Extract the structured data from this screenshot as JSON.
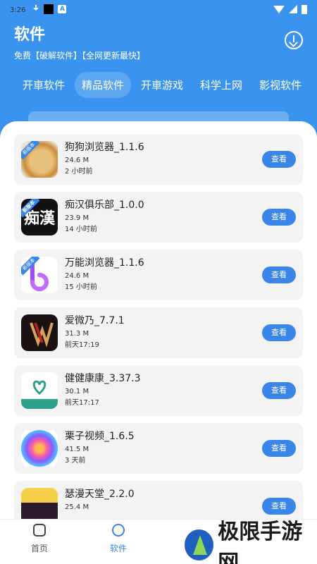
{
  "status": {
    "time": "3:26"
  },
  "header": {
    "title": "软件",
    "subtitle": "免费【破解软件】【全网更新最快】"
  },
  "tabs": [
    {
      "label": "开車软件"
    },
    {
      "label": "精品软件",
      "active": true
    },
    {
      "label": "开車游戏"
    },
    {
      "label": "科学上网"
    },
    {
      "label": "影视软件"
    }
  ],
  "apps": [
    {
      "name": "狗狗浏览器_1.1.6",
      "size": "24.6 M",
      "time": "2 小时前",
      "button": "查看",
      "icon": "doge-icon",
      "tag": "新版本"
    },
    {
      "name": "痴汉俱乐部_1.0.0",
      "size": "23.9 M",
      "time": "14 小时前",
      "button": "查看",
      "icon": "chihan-icon",
      "tag": "新版本"
    },
    {
      "name": "万能浏览器_1.1.6",
      "size": "24.6 M",
      "time": "15 小时前",
      "button": "查看",
      "icon": "wanneng-icon",
      "tag": "新版本"
    },
    {
      "name": "爱微乃_7.7.1",
      "size": "31.3 M",
      "time": "前天17:19",
      "button": "查看",
      "icon": "aiweinai-icon"
    },
    {
      "name": "健健康康_3.37.3",
      "size": "30.1 M",
      "time": "前天17:17",
      "button": "查看",
      "icon": "jiankang-icon"
    },
    {
      "name": "栗子视频_1.6.5",
      "size": "41.5 M",
      "time": "3 天前",
      "button": "查看",
      "icon": "lizi-icon"
    },
    {
      "name": "瑟漫天堂_2.2.0",
      "size": "25.4 M",
      "time": "",
      "button": "查看",
      "icon": "seman-icon"
    }
  ],
  "bottom_nav": [
    {
      "label": "首页",
      "icon": "home-icon"
    },
    {
      "label": "软件",
      "icon": "software-icon",
      "active": true
    }
  ],
  "watermark": {
    "text": "极限手游网"
  }
}
